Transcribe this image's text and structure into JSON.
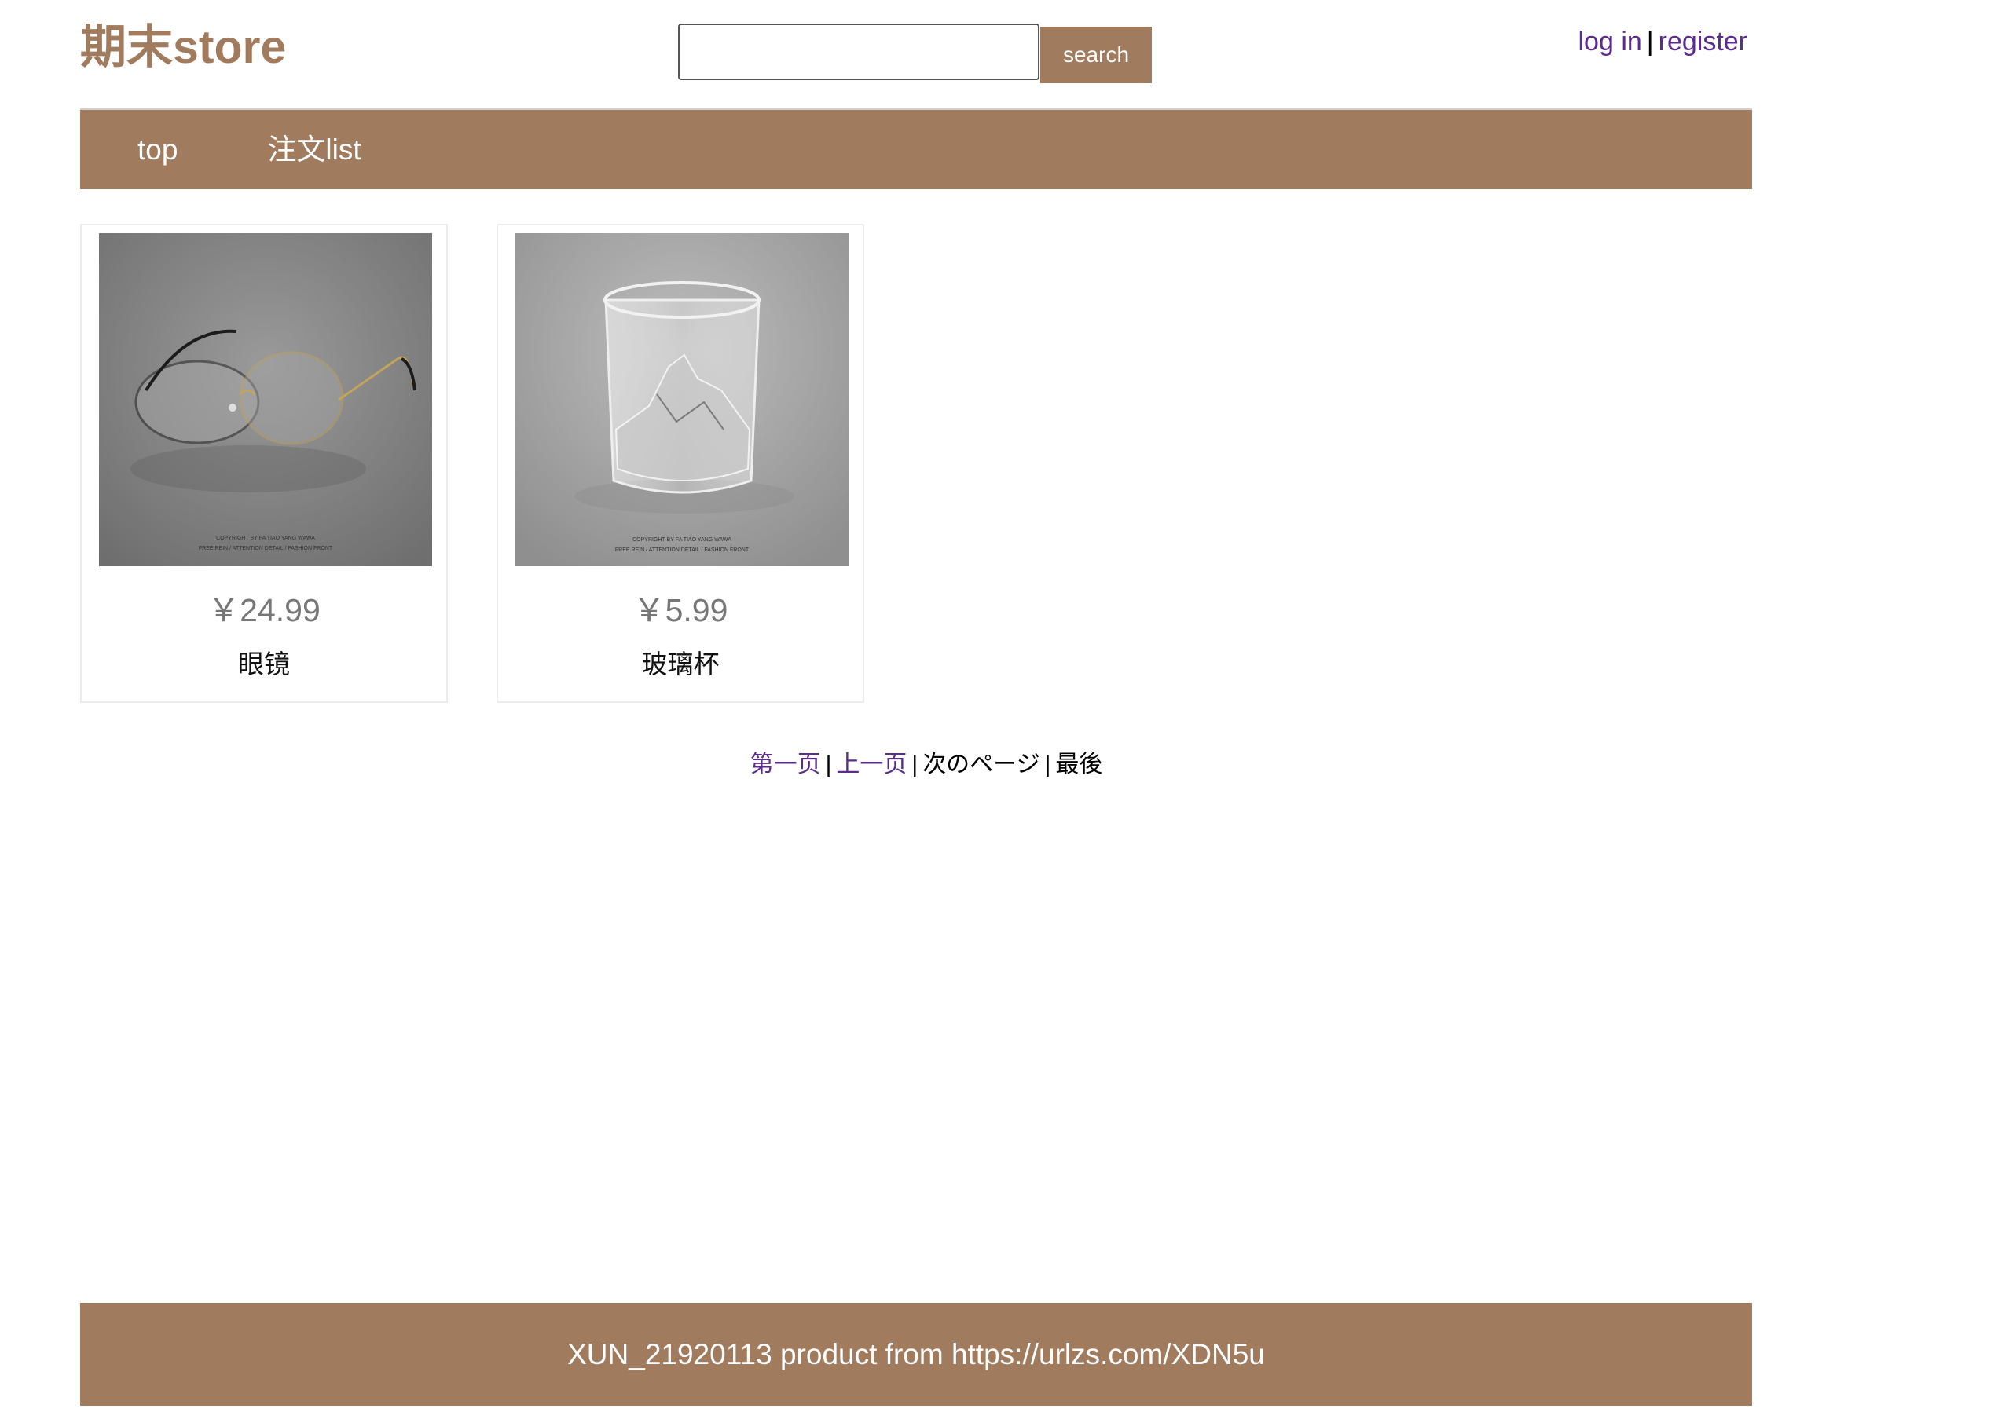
{
  "header": {
    "logo": "期末store",
    "search": {
      "value": "",
      "placeholder": "",
      "button_label": "search"
    },
    "auth": {
      "login_label": "log in",
      "separator": "|",
      "register_label": "register"
    }
  },
  "nav": {
    "items": [
      {
        "label": "top"
      },
      {
        "label": "注文list"
      }
    ]
  },
  "products": [
    {
      "price": "￥24.99",
      "name": "眼镜",
      "image_icon": "glasses-image",
      "image_caption_1": "COPYRIGHT BY FA TIAO YANG WAWA",
      "image_caption_2": "FREE REIN / ATTENTION DETAIL / FASHION FRONT"
    },
    {
      "price": "￥5.99",
      "name": "玻璃杯",
      "image_icon": "glass-cup-image",
      "image_caption_1": "COPYRIGHT BY FA TIAO YANG WAWA",
      "image_caption_2": "FREE REIN / ATTENTION DETAIL / FASHION FRONT"
    }
  ],
  "pagination": {
    "first": "第一页",
    "prev": "上一页",
    "next": "次のページ",
    "last": "最後",
    "separator": "|"
  },
  "footer": {
    "text": "XUN_21920113 product from https://urlzs.com/XDN5u"
  },
  "colors": {
    "brand": "#a07b5e",
    "link": "#5c2c8c"
  }
}
